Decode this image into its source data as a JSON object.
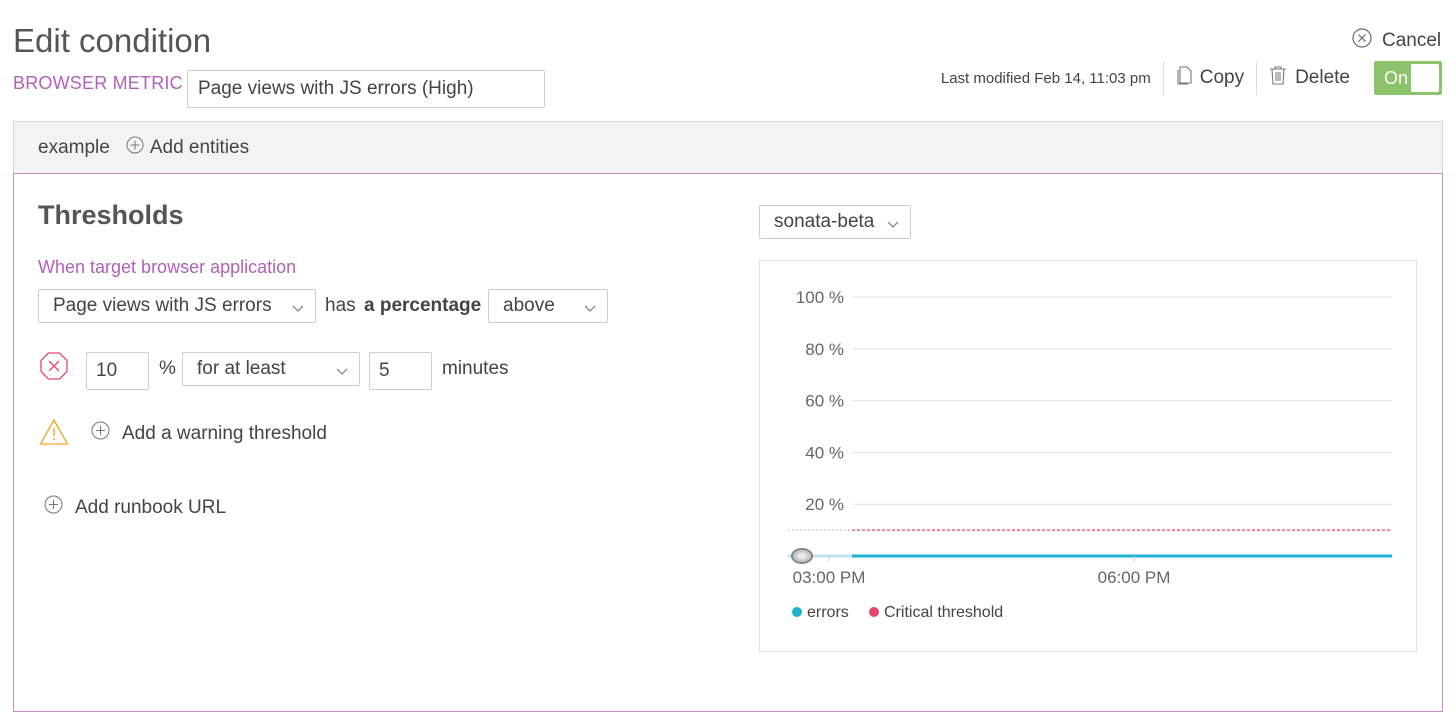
{
  "header": {
    "title": "Edit condition",
    "metric_type": "BROWSER METRIC",
    "condition_name": "Page views with JS errors (High)",
    "cancel_label": "Cancel",
    "last_modified": "Last modified Feb 14, 11:03 pm",
    "copy_label": "Copy",
    "delete_label": "Delete",
    "toggle_label": "On",
    "enabled": true
  },
  "entities": {
    "entity": "example",
    "add_label": "Add entities"
  },
  "thresholds": {
    "title": "Thresholds",
    "when_label": "When target browser application",
    "metric_select": "Page views with JS errors",
    "has_text": "has",
    "aggregation": "a percentage",
    "operator_select": "above",
    "critical_value": "10",
    "unit": "%",
    "duration_select": "for at least",
    "duration_value": "5",
    "duration_unit": "minutes",
    "add_warning_label": "Add a warning threshold",
    "add_runbook_label": "Add runbook URL"
  },
  "chart_panel": {
    "app_select": "sonata-beta"
  },
  "colors": {
    "accent": "#b260b8",
    "toggle_on": "#8cc26a",
    "errors_series": "#1cb3d3",
    "critical_threshold": "#e5466b",
    "warning": "#f5a623"
  },
  "chart_data": {
    "type": "line",
    "y_ticks": [
      "100 %",
      "80 %",
      "60 %",
      "40 %",
      "20 %"
    ],
    "y_tick_values": [
      100,
      80,
      60,
      40,
      20
    ],
    "x_ticks": [
      "03:00 PM",
      "06:00 PM"
    ],
    "ylim": [
      0,
      100
    ],
    "grid": true,
    "legend_position": "bottom-left",
    "series": [
      {
        "name": "errors",
        "color": "#1cb3d3",
        "values": [
          0,
          0,
          0,
          0,
          0
        ]
      },
      {
        "name": "Critical threshold",
        "color": "#e5466b",
        "values": [
          10,
          10,
          10,
          10,
          10
        ]
      }
    ]
  }
}
